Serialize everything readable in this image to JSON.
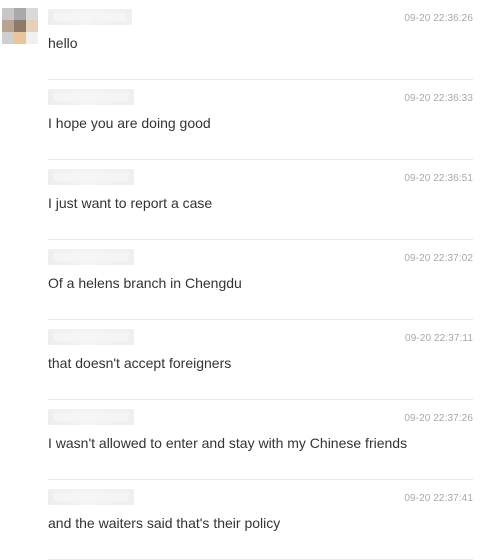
{
  "avatar": {
    "pixels": [
      "#c7c7c7",
      "#a9a9a9",
      "#d9d9d9",
      "#b7a38f",
      "#8d7a6b",
      "#e6d0b6",
      "#cfcfcf",
      "#e8c59a",
      "#f0f0f0"
    ]
  },
  "messages": [
    {
      "time": "09-20 22:36:26",
      "text": "hello"
    },
    {
      "time": "09-20 22:36:33",
      "text": "I hope you are doing good"
    },
    {
      "time": "09-20 22:36:51",
      "text": "I just want to report a case"
    },
    {
      "time": "09-20 22:37:02",
      "text": "Of a helens branch in Chengdu"
    },
    {
      "time": "09-20 22:37:11",
      "text": "that doesn't accept foreigners"
    },
    {
      "time": "09-20 22:37:26",
      "text": "I wasn't allowed to enter and stay with my Chinese friends"
    },
    {
      "time": "09-20 22:37:41",
      "text": "and the waiters said that's their policy"
    }
  ]
}
